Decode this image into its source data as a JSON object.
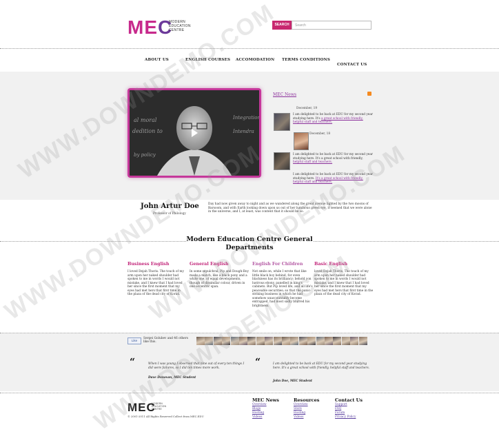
{
  "header": {
    "logo": {
      "text": "MEC",
      "sub": [
        "MODERN",
        "EDUCATION",
        "CENTRE"
      ]
    },
    "search": {
      "button": "SEARCH",
      "placeholder": "Search"
    }
  },
  "nav": {
    "items": [
      "ABOUT US",
      "ENGLISH COURSES",
      "ACCOMODATION",
      "TERMS CONDITIONS",
      "CONTACT US"
    ]
  },
  "hero": {
    "video": {
      "play_icon": "play-icon",
      "board_words": [
        "al moral",
        "dedition to",
        "Integration",
        "Intendra",
        "by policy"
      ]
    },
    "news": {
      "title": "MEC News",
      "rss_icon": "rss-icon",
      "items": [
        {
          "date": "December, 19",
          "text": "I am delighted to be back at EDU for my second year studying here. It's",
          "link": "a great school with friendly, helpful staff and teachers."
        },
        {
          "date": "December, 18",
          "text": "",
          "link": ""
        },
        {
          "date": "",
          "text": "I am delighted to be back at EDU for my second year studying here. It's a great school with friendly,",
          "link": "helpful staff and teachers."
        },
        {
          "date": "",
          "text": "I am delighted to be back at EDU for my second year studying here.",
          "link": "It's a great school with friendly, helpful staff and teachers."
        }
      ]
    },
    "person": {
      "name": "John Artur Doe",
      "role": "Professor of Philology"
    },
    "quote": "Day had now given away to night and as we wandered along the great avenue lighted by the two moons of Barsoom, and with Earth looking down upon us out of her luminous green eye, it seemed that we were alone in the universe, and I, at least, was content that it should be so."
  },
  "departments": {
    "title": "Modern Education Centre General Departments",
    "items": [
      {
        "title": "Business English",
        "color": "#c2267a",
        "text": "I loved Dejah Thoris. The touch of my arm upon her naked shoulder had spoken to me in words I would not mistake, and I knew that I had loved her since the first moment that my eyes had met hers that first time in the plaza of the dead city of Korad."
      },
      {
        "title": "General English",
        "color": "#c2267a",
        "text": "In some sepulchral, Pip and Dough-Boy made a match, like a black pony and a white one, of equal developments, though of dissimilar colour, driven in one eccentric span."
      },
      {
        "title": "English For Children",
        "color": "#b45aa4",
        "text": "Not smile on, while I wrote that like little black boy behind, for even blackness has its brilliancy; behold yon lustrous ebony, panelled in king's cabinets. But Pip loved life, and all life's peaceable securities; so that the panic-striking business in which he had somehow unaccountably become entrapped, had most sadly blurred his brightness."
      },
      {
        "title": "Basic English",
        "color": "#c2267a",
        "text": "loved Dejah Thoris. The touch of my arm upon her naked shoulder had spoken to me in words I would not mistake, and I knew that I had loved her since the first moment that my eyes had met hers that first time in the plaza of the dead city of Korad."
      }
    ]
  },
  "social": {
    "like_label": "Like",
    "text": "Sergei Golubev and 46 others like this.",
    "avatar_count": 20
  },
  "testimonials": [
    {
      "text": "When I was young I observed that nine out of every ten things I did were failures, so I did ten times more work.",
      "author": "Dave Donovan, MEC Student"
    },
    {
      "text": "I am delighted to be back at EDU for my second year studying here. It's a great school with friendly, helpful staff and teachers.",
      "author": "John Doe, MEC Student"
    }
  ],
  "footer": {
    "copyright": "© 2001-2011 All Rights Reserved Collect from MEC.EDU",
    "columns": [
      {
        "title": "MEC News",
        "links": [
          "Overview",
          "Blogs",
          "Hosting",
          "Videos"
        ]
      },
      {
        "title": "Resources",
        "links": [
          "Overview",
          "Store",
          "Hosting",
          "Videos"
        ]
      },
      {
        "title": "Contact Us",
        "links": [
          "Support",
          "FAQ",
          "Forum",
          "Privacy Policy"
        ]
      }
    ]
  },
  "watermark": "WWW.DOWNDEMO.COM",
  "colors": {
    "accent": "#c8276f",
    "purple": "#6c3a9a",
    "band": "#f1f1f1"
  }
}
